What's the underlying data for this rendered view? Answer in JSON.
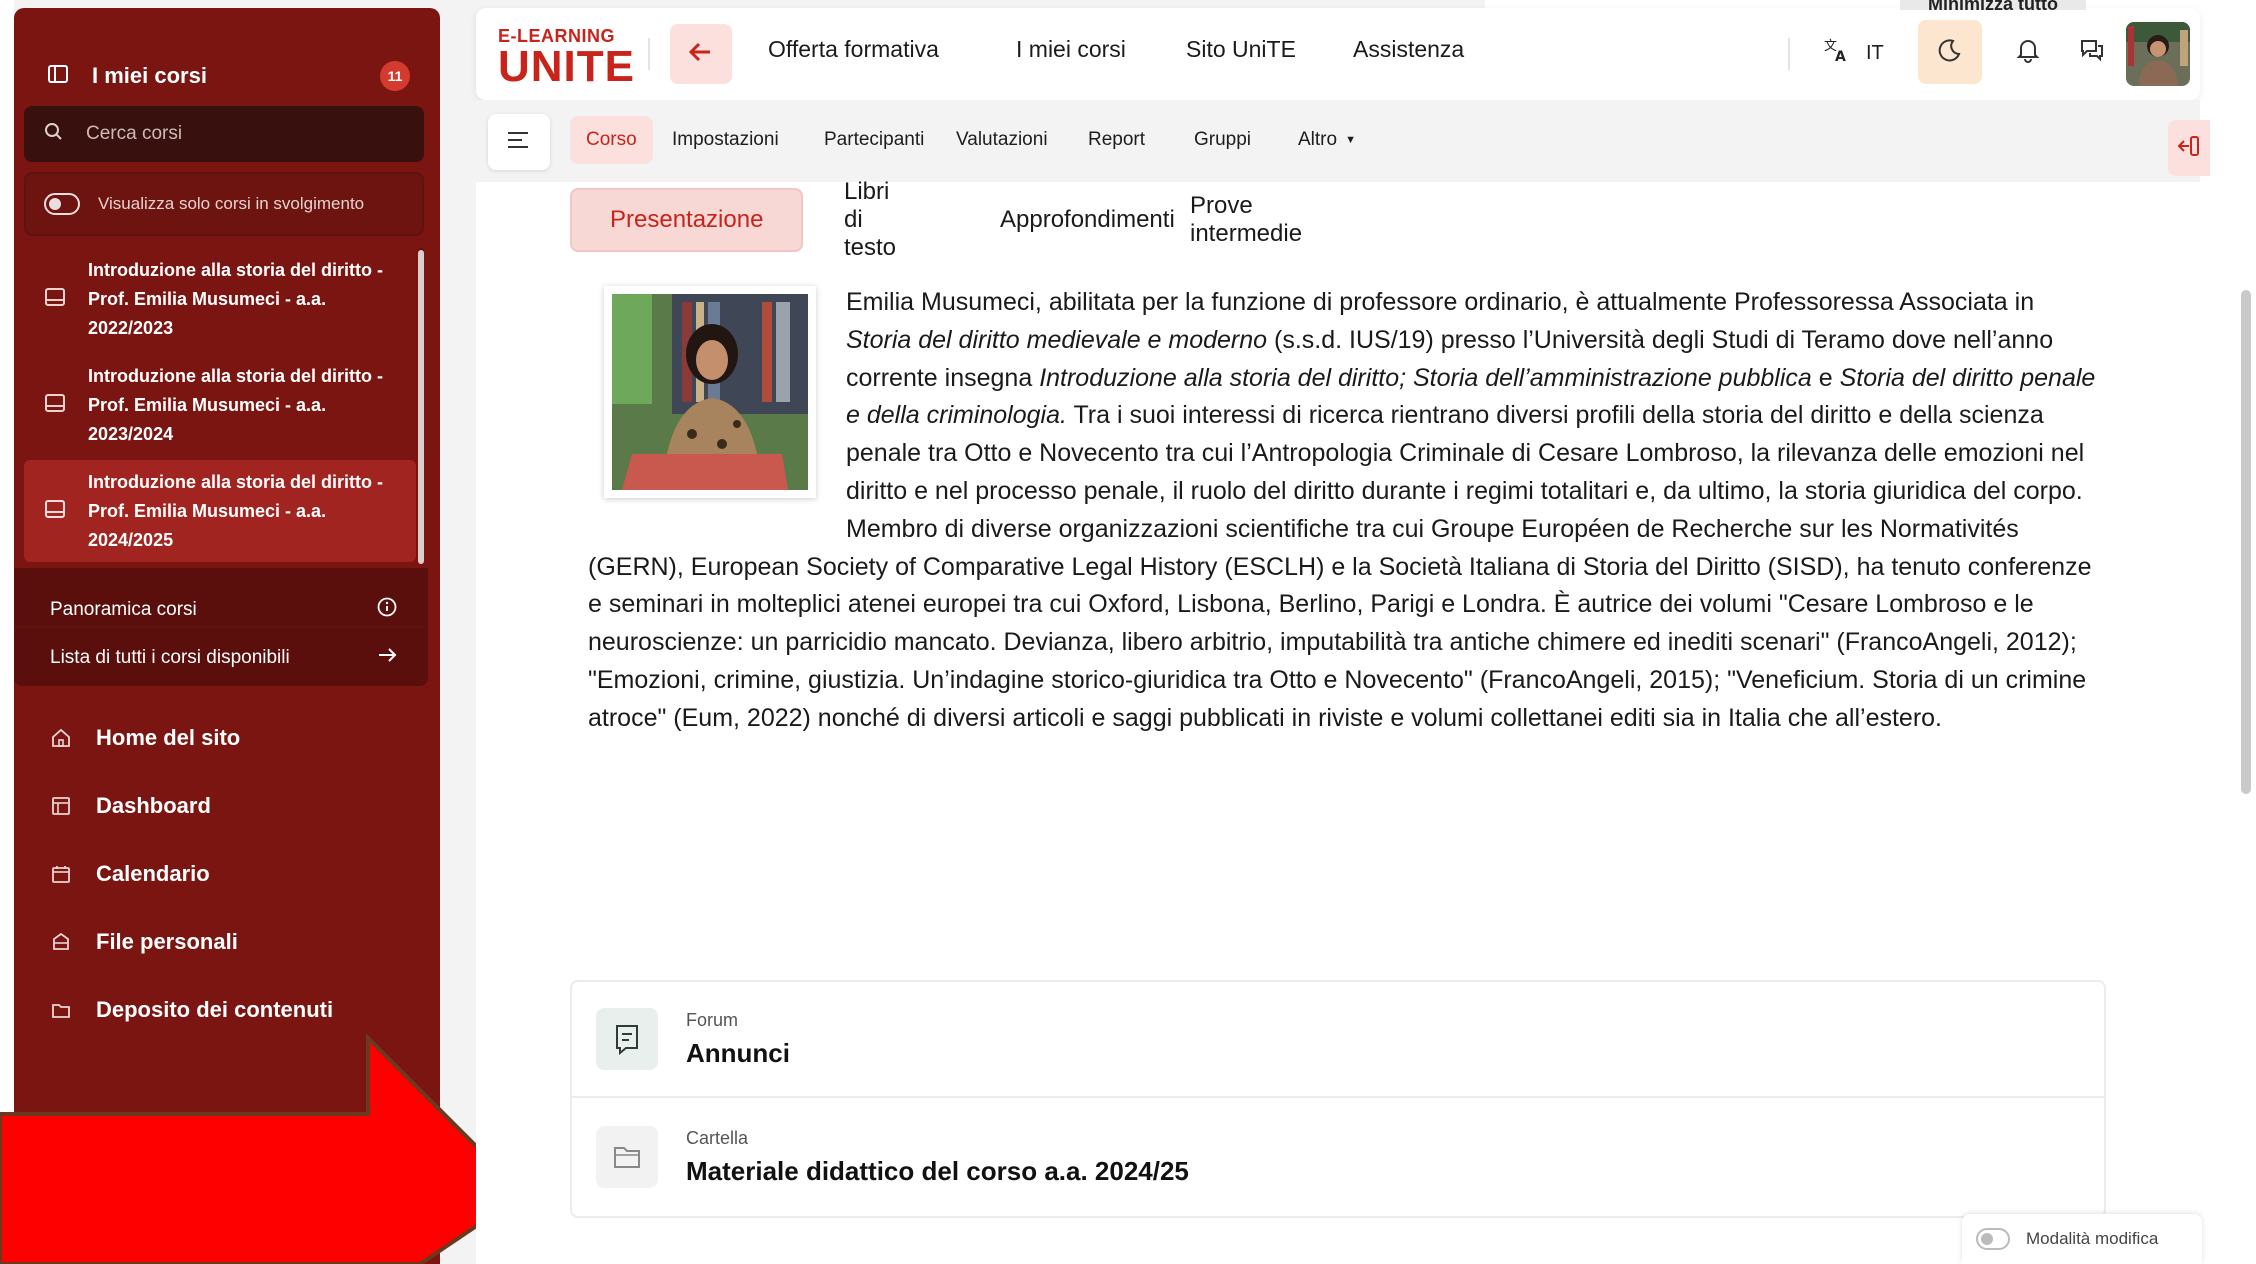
{
  "sidebar": {
    "title": "I miei corsi",
    "badge": "11",
    "search_placeholder": "Cerca corsi",
    "toggle_label": "Visualizza solo corsi in svolgimento",
    "courses": [
      {
        "label": "Introduzione alla storia del diritto - Prof. Emilia Musumeci - a.a. 2022/2023"
      },
      {
        "label": "Introduzione alla storia del diritto - Prof. Emilia Musumeci - a.a. 2023/2024"
      },
      {
        "label": "Introduzione alla storia del diritto - Prof. Emilia Musumeci - a.a. 2024/2025"
      }
    ],
    "links": {
      "overview": "Panoramica corsi",
      "all_courses": "Lista di tutti i corsi disponibili"
    },
    "nav": [
      {
        "label": "Home del sito",
        "icon": "home-icon"
      },
      {
        "label": "Dashboard",
        "icon": "dashboard-icon"
      },
      {
        "label": "Calendario",
        "icon": "calendar-icon"
      },
      {
        "label": "File personali",
        "icon": "files-icon"
      },
      {
        "label": "Deposito dei contenuti",
        "icon": "folder-icon"
      }
    ]
  },
  "header": {
    "logo_top": "E-LEARNING",
    "logo_bottom": "UNITE",
    "nav": [
      "Offerta formativa",
      "I miei corsi",
      "Sito UniTE",
      "Assistenza"
    ],
    "language": "IT",
    "minimize_label": "Minimizza tutto"
  },
  "course_nav": {
    "tabs": [
      "Corso",
      "Impostazioni",
      "Partecipanti",
      "Valutazioni",
      "Report",
      "Gruppi",
      "Altro"
    ],
    "active": "Corso"
  },
  "content_tabs": {
    "tabs": [
      "Presentazione",
      "Libri di testo",
      "Approfondimenti",
      "Prove intermedie"
    ],
    "active": "Presentazione"
  },
  "bio": {
    "p1": "Emilia Musumeci, abilitata per la funzione di professore ordinario, è attualmente Professoressa Associata in ",
    "i1": "Storia del diritto medievale e moderno",
    "p2": " (s.s.d. IUS/19) presso l’Università degli Studi di Teramo dove nell’anno corrente insegna ",
    "i2": "Introduzione alla storia del diritto; Storia dell’amministrazione pubblica",
    "p3": " e ",
    "i3": "Storia del diritto penale e della criminologia.",
    "p4": " Tra i suoi interessi di ricerca rientrano diversi profili della storia del diritto e della scienza penale tra Otto e Novecento tra cui l’Antropologia Criminale di Cesare Lombroso, la rilevanza delle emozioni nel diritto e nel processo penale, il ruolo del diritto durante i regimi totalitari e, da ultimo, la storia giuridica del corpo. Membro di diverse organizzazioni scientifiche tra cui Groupe Européen de Recherche sur les Normativités (GERN), European Society of Comparative Legal History (ESCLH) e la Società Italiana di Storia del Diritto (SISD), ha tenuto conferenze e seminari in molteplici atenei europei tra cui Oxford, Lisbona, Berlino, Parigi e Londra. È autrice dei volumi \"Cesare Lombroso e le neuroscienze: un parricidio mancato. Devianza, libero arbitrio, imputabilità tra antiche chimere ed inediti scenari\" (FrancoAngeli, 2012); \"Emozioni, crimine, giustizia. Un’indagine storico-giuridica tra Otto e Novecento\" (FrancoAngeli, 2015); \"Veneficium. Storia di un crimine atroce\" (Eum, 2022) nonché di diversi articoli e saggi pubblicati in riviste e volumi collettanei editi sia in Italia che all’estero."
  },
  "activities": [
    {
      "type": "Forum",
      "name": "Annunci",
      "icon": "forum-icon",
      "color": "#e8efec"
    },
    {
      "type": "Cartella",
      "name": "Materiale didattico del corso a.a. 2024/25",
      "icon": "folder-icon",
      "color": "#f2f2f2"
    }
  ],
  "edit_mode_label": "Modalità modifica",
  "colors": {
    "brand_red": "#c8241b",
    "sidebar_bg": "#7a1512",
    "active_tab_bg": "#fbe0de",
    "annotation_arrow": "#ff0000"
  }
}
